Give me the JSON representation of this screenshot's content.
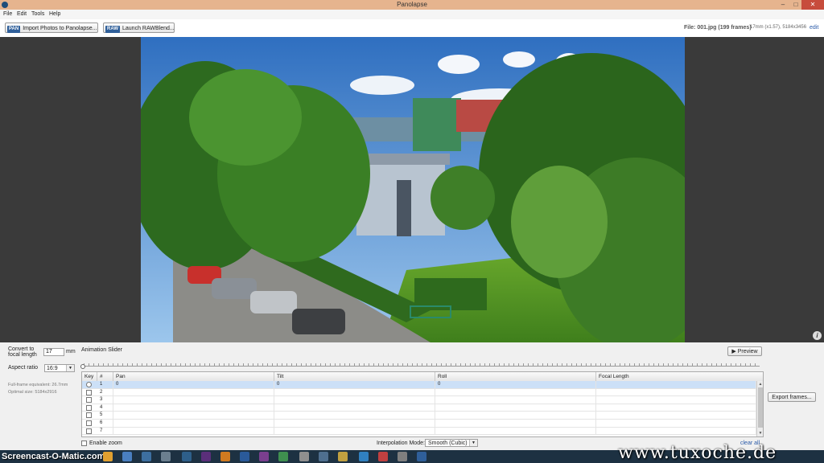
{
  "window": {
    "title": "Panolapse",
    "controls": [
      "–",
      "□",
      "✕"
    ]
  },
  "menu": {
    "items": [
      "File",
      "Edit",
      "Tools",
      "Help"
    ]
  },
  "toolbar": {
    "import_tag": "PAN",
    "import_label": "Import Photos to Panolapse...",
    "raw_tag": "RAW",
    "raw_label": "Launch RAWBlend...",
    "file_info": "File: 001.jpg (199 frames)",
    "lens_info": "17mm (x1.57), 5184x3456",
    "edit_link": "edit"
  },
  "settings": {
    "convert_label_1": "Convert to",
    "convert_label_2": "focal length",
    "focal_value": "17",
    "focal_unit": "mm",
    "aspect_label": "Aspect ratio",
    "aspect_value": "16:9",
    "hint_full_frame": "Full-frame equivalent: 26.7mm",
    "hint_optimal": "Optimal size: 5184x2916"
  },
  "animation": {
    "label": "Animation Slider",
    "preview_label": "▶ Preview",
    "export_label": "Export frames..."
  },
  "keyframes": {
    "columns": [
      "Key",
      "#",
      "Pan",
      "Tilt",
      "Roll",
      "Focal Length"
    ],
    "rows": [
      {
        "num": "1",
        "pan": "0",
        "tilt": "0",
        "roll": "0",
        "focal": ""
      },
      {
        "num": "2",
        "pan": "",
        "tilt": "",
        "roll": "",
        "focal": ""
      },
      {
        "num": "3",
        "pan": "",
        "tilt": "",
        "roll": "",
        "focal": ""
      },
      {
        "num": "4",
        "pan": "",
        "tilt": "",
        "roll": "",
        "focal": ""
      },
      {
        "num": "5",
        "pan": "",
        "tilt": "",
        "roll": "",
        "focal": ""
      },
      {
        "num": "6",
        "pan": "",
        "tilt": "",
        "roll": "",
        "focal": ""
      },
      {
        "num": "7",
        "pan": "",
        "tilt": "",
        "roll": "",
        "focal": ""
      }
    ]
  },
  "bottom": {
    "enable_zoom": "Enable zoom",
    "interp_label": "Interpolation Mode:",
    "interp_value": "Smooth (Cubic)",
    "clear_all": "clear all"
  },
  "watermarks": {
    "left": "Screencast-O-Matic.com",
    "right": "www.tuxoche.de"
  },
  "colors": {
    "titlebar": "#e6b48e",
    "accent": "#2f5f9a",
    "selection": "#cce0f7",
    "taskbar": "#1d3142"
  }
}
